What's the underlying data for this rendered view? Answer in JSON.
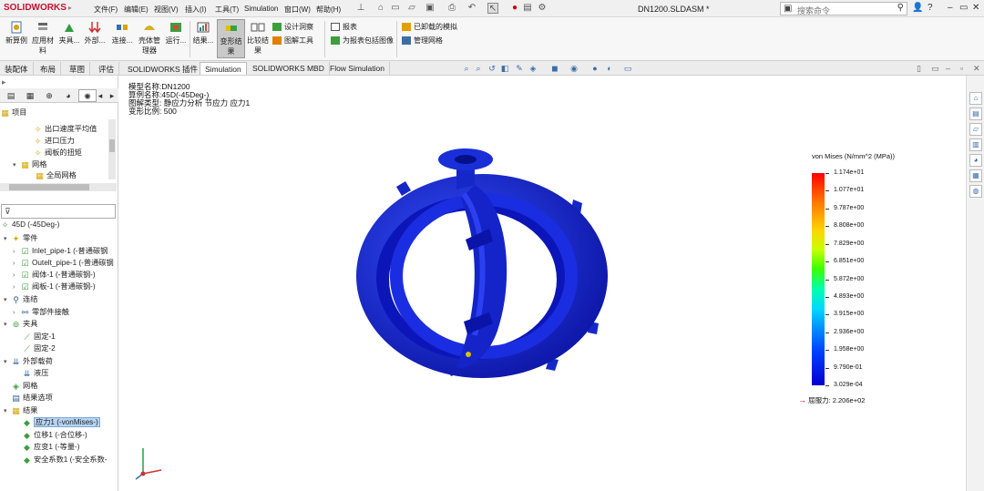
{
  "app": {
    "logo": "SOLIDWORKS",
    "menus": [
      "文件(F)",
      "编辑(E)",
      "视图(V)",
      "插入(I)",
      "工具(T)",
      "Simulation",
      "窗口(W)",
      "帮助(H)"
    ],
    "doc_title": "DN1200.SLDASM *",
    "search_placeholder": "搜索命令"
  },
  "ribbon": {
    "new_study": "新算例",
    "apply_material": "应用材料",
    "fixtures": "夹具...",
    "external_loads": "外部...",
    "connections": "连接...",
    "shell_manager": "壳体管理器",
    "run": "运行...",
    "results": "结果...",
    "deformed_result": "变形结果",
    "compare_results": "比较结果",
    "design_insight": "设计洞察",
    "plot_tools": "图解工具",
    "report": "报表",
    "include_image": "为报表包括图像",
    "unloaded_sims": "已卸载的模拟",
    "manage_mesh": "管理网格"
  },
  "tabs": [
    "装配体",
    "布局",
    "草图",
    "评估",
    "SOLIDWORKS 插件",
    "Simulation",
    "SOLIDWORKS MBD",
    "Flow Simulation"
  ],
  "active_tab": "Simulation",
  "upper_tree": {
    "root": "项目",
    "items": [
      "出口速度平均值",
      "进口压力",
      "阀板的扭矩",
      "网格",
      "全局网格"
    ]
  },
  "filter_icon": "filter-icon",
  "study_tree": {
    "study": "45D (-45Deg-)",
    "parts": "零件",
    "part_items": [
      "Inlet_pipe-1 (-普通碳钢",
      "Outelt_pipe-1 (-普通碳钢",
      "阀体-1 (-普通碳钢-)",
      "阀板-1 (-普通碳钢-)"
    ],
    "connections": "连结",
    "contact": "零部件接触",
    "fixtures": "夹具",
    "fixture_items": [
      "固定-1",
      "固定-2"
    ],
    "loads": "外部载荷",
    "pressure": "液压",
    "mesh": "网格",
    "result_options": "结果选项",
    "results": "结果",
    "result_items": [
      "应力1 (-vonMises-)",
      "位移1 (-合位移-)",
      "应变1 (-等量-)",
      "安全系数1 (-安全系数-"
    ]
  },
  "viewport": {
    "info": [
      "模型名称:DN1200",
      "算例名称:45D(-45Deg-)",
      "图解类型: 静应力分析 节应力 应力1",
      "变形比例: 500"
    ],
    "legend_title": "von Mises (N/mm^2 (MPa))",
    "legend_ticks": [
      "1.174e+01",
      "1.077e+01",
      "9.787e+00",
      "8.808e+00",
      "7.829e+00",
      "6.851e+00",
      "5.872e+00",
      "4.893e+00",
      "3.915e+00",
      "2.936e+00",
      "1.958e+00",
      "9.790e-01",
      "3.029e-04"
    ],
    "yield": "屈服力: 2.206e+02",
    "model_color": "#1a2fd8"
  }
}
